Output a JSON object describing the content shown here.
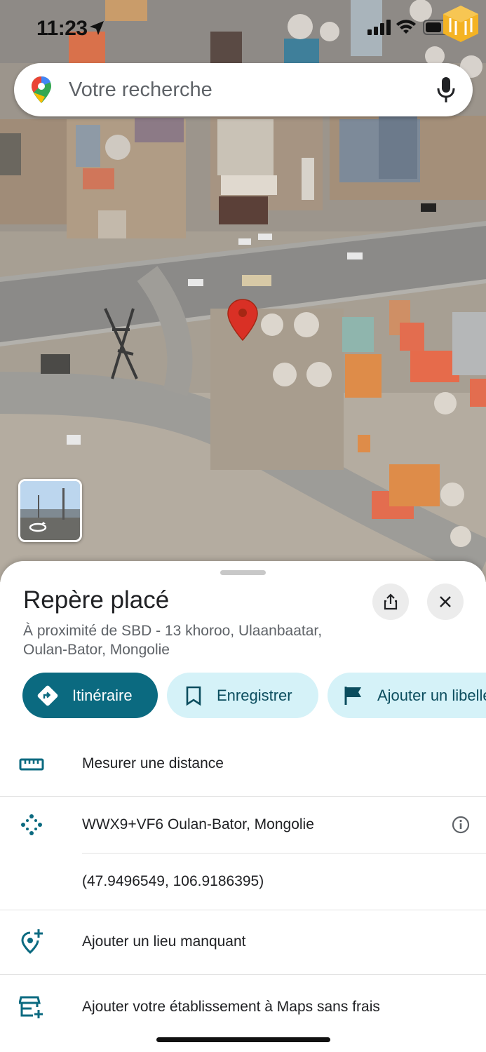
{
  "status_bar": {
    "time": "11:23",
    "icons": [
      "location-arrow-icon",
      "cellular-signal-icon",
      "wifi-icon",
      "battery-icon"
    ]
  },
  "search": {
    "placeholder": "Votre recherche",
    "icons": [
      "google-maps-logo",
      "microphone-icon"
    ]
  },
  "map": {
    "view": "satellite",
    "marker": "red-pin-icon",
    "street_view_icon": "street-view-rotate-icon"
  },
  "place_sheet": {
    "title": "Repère placé",
    "address_line1": "À proximité de SBD - 13 khoroo, Ulaanbaatar,",
    "address_line2": "Oulan-Bator, Mongolie",
    "actions": {
      "directions": "Itinéraire",
      "save": "Enregistrer",
      "label": "Ajouter un libellé"
    },
    "rows": {
      "measure": "Mesurer une distance",
      "plus_code": "WWX9+VF6 Oulan-Bator, Mongolie",
      "coordinates": "(47.9496549, 106.9186395)",
      "add_place": "Ajouter un lieu manquant",
      "add_business": "Ajouter votre établissement à Maps sans frais"
    }
  },
  "colors": {
    "accent": "#0b6a80",
    "chip_bg": "#d5f2f8",
    "chip_text": "#0b4d5e",
    "pin": "#d93025",
    "icon_teal": "#0b6a80"
  }
}
